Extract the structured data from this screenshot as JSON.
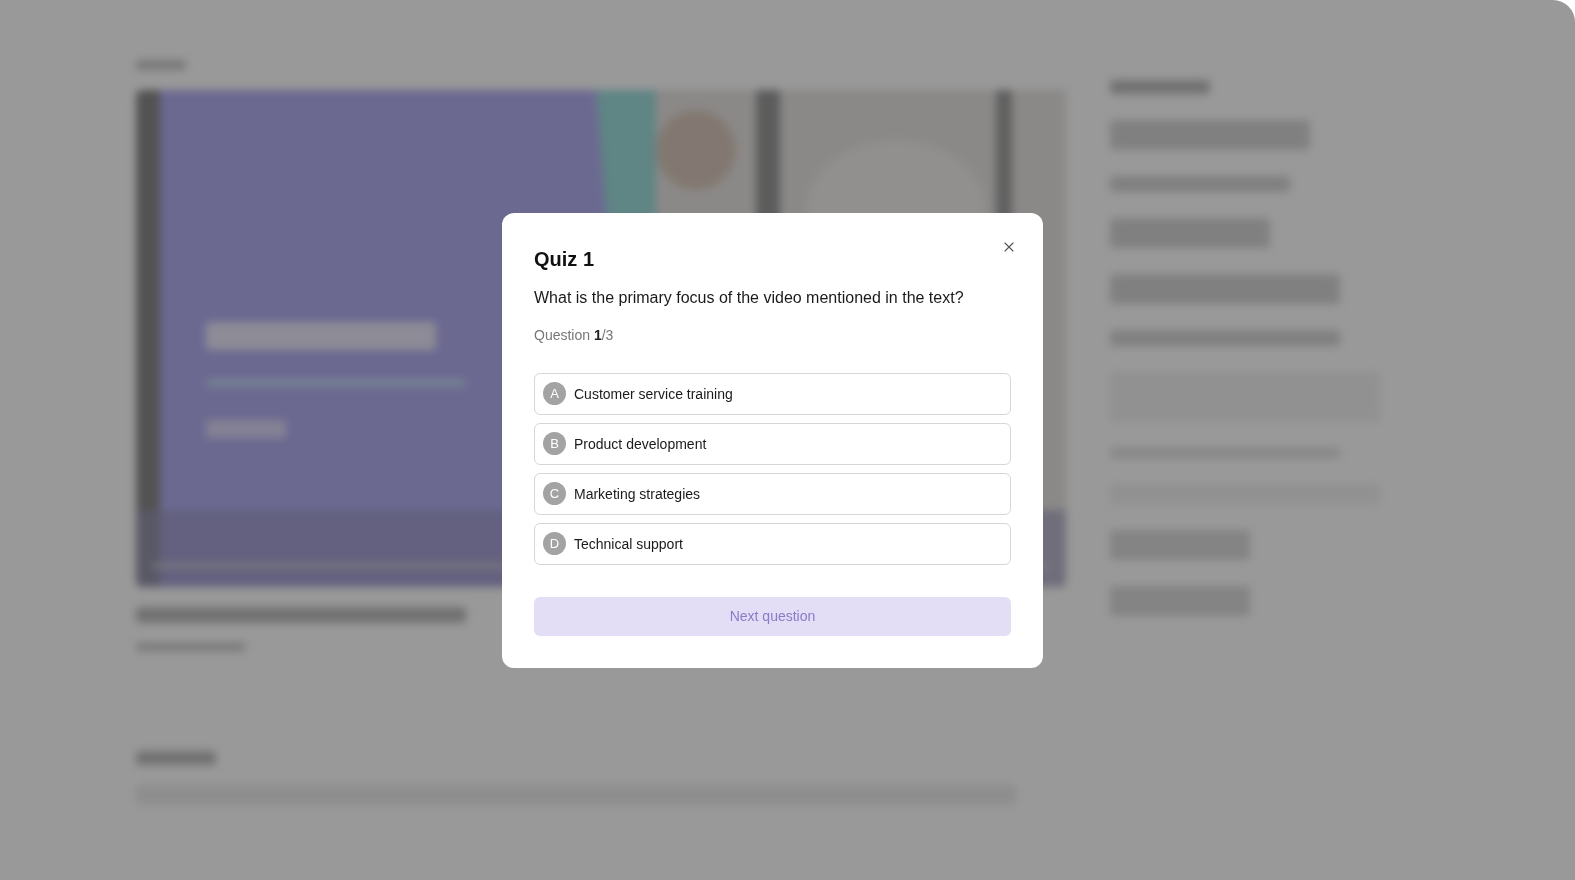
{
  "quiz": {
    "title": "Quiz 1",
    "question": "What is the primary focus of the video mentioned in the text?",
    "progress": "Question **1**/3",
    "options": [
      {
        "letter": "A",
        "text": "Customer service training",
        "selected": false
      },
      {
        "letter": "B",
        "text": "Product development",
        "selected": false
      },
      {
        "letter": "C",
        "text": "Marketing strategies",
        "selected": false
      },
      {
        "letter": "D",
        "text": "Technical support",
        "selected": false
      }
    ],
    "next_button": {
      "label": "Next question",
      "disabled": true
    }
  }
}
